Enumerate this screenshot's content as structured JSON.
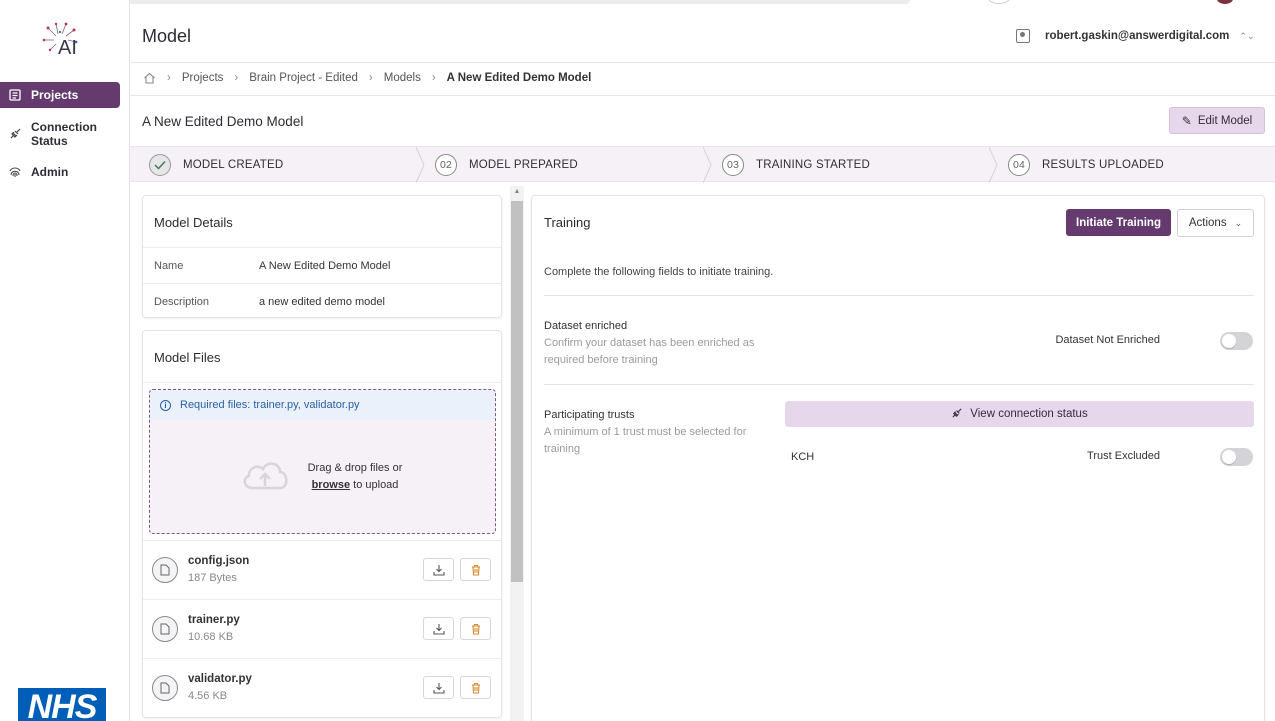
{
  "header": {
    "title": "Model",
    "user_email": "robert.gaskin@answerdigital.com"
  },
  "sidebar": {
    "logo_text": "AI",
    "items": [
      {
        "label": "Projects",
        "icon": "projects-icon",
        "active": true
      },
      {
        "label": "Connection Status",
        "icon": "plug-icon",
        "active": false
      },
      {
        "label": "Admin",
        "icon": "fingerprint-icon",
        "active": false
      }
    ],
    "footer_logo": "NHS"
  },
  "breadcrumb": {
    "items": [
      "Projects",
      "Brain Project - Edited",
      "Models",
      "A New Edited Demo Model"
    ]
  },
  "model": {
    "name": "A New Edited Demo Model",
    "edit_label": "Edit Model"
  },
  "stepper": {
    "steps": [
      {
        "num": "",
        "label": "MODEL CREATED",
        "done": true
      },
      {
        "num": "02",
        "label": "MODEL PREPARED",
        "done": false
      },
      {
        "num": "03",
        "label": "TRAINING STARTED",
        "done": false
      },
      {
        "num": "04",
        "label": "RESULTS UPLOADED",
        "done": false
      }
    ]
  },
  "details": {
    "title": "Model Details",
    "rows": [
      {
        "key": "Name",
        "value": "A New Edited Demo Model"
      },
      {
        "key": "Description",
        "value": "a new edited demo model"
      }
    ]
  },
  "files": {
    "title": "Model Files",
    "required": "Required files: trainer.py, validator.py",
    "drop_text": "Drag & drop files or",
    "browse": "browse",
    "to_upload": "to upload",
    "items": [
      {
        "name": "config.json",
        "size": "187 Bytes"
      },
      {
        "name": "trainer.py",
        "size": "10.68 KB"
      },
      {
        "name": "validator.py",
        "size": "4.56 KB"
      }
    ]
  },
  "training": {
    "title": "Training",
    "initiate_label": "Initiate Training",
    "actions_label": "Actions",
    "subtitle": "Complete the following fields to initiate training.",
    "dataset_label": "Dataset enriched",
    "dataset_help": "Confirm your dataset has been enriched as required before training",
    "dataset_toggle_label": "Dataset Not Enriched",
    "trusts_label": "Participating trusts",
    "trusts_help": "A minimum of 1 trust must be selected for training",
    "connection_label": "View connection status",
    "trusts": [
      {
        "name": "KCH",
        "toggle_label": "Trust Excluded"
      }
    ]
  },
  "colors": {
    "primary": "#653a6e",
    "primary_light": "#e6d7ea",
    "stepper_bg": "#f6f0f7",
    "nhs_blue": "#005eb8"
  }
}
